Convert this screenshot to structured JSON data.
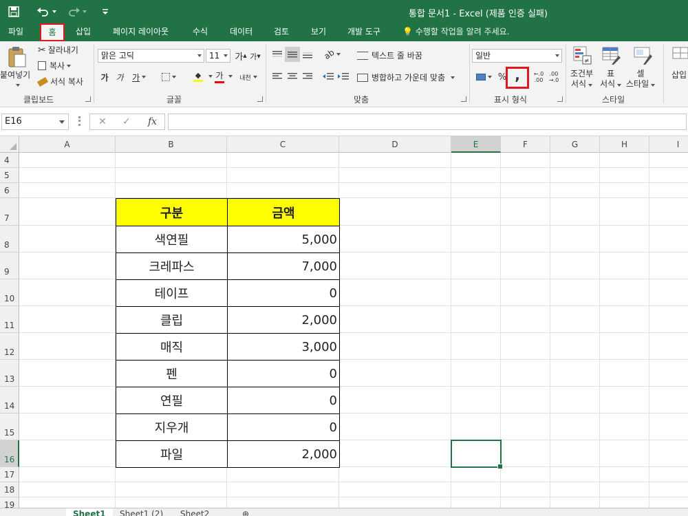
{
  "window": {
    "title": "통합 문서1 - Excel (제품 인증 실패)"
  },
  "quick_access": {
    "save_icon": "save-icon",
    "undo_icon": "undo-icon",
    "redo_icon": "redo-icon",
    "customize_icon": "customize-icon"
  },
  "tabs": [
    {
      "label": "파일"
    },
    {
      "label": "홈",
      "active": true
    },
    {
      "label": "삽입"
    },
    {
      "label": "페이지 레이아웃"
    },
    {
      "label": "수식"
    },
    {
      "label": "데이터"
    },
    {
      "label": "검토"
    },
    {
      "label": "보기"
    },
    {
      "label": "개발 도구"
    }
  ],
  "tell_me": "수행할 작업을 알려 주세요.",
  "ribbon": {
    "clipboard": {
      "paste": "붙여넣기",
      "cut": "잘라내기",
      "copy": "복사",
      "format_painter": "서식 복사",
      "label": "클립보드"
    },
    "font": {
      "name": "맑은 고딕",
      "size": "11",
      "grow": "가",
      "shrink": "가",
      "bold": "가",
      "italic": "가",
      "underline": "가",
      "font_color": "가",
      "phonetic": "내천",
      "label": "글꼴"
    },
    "alignment": {
      "wrap_text": "텍스트 줄 바꿈",
      "merge_center": "병합하고 가운데 맞춤",
      "label": "맞춤"
    },
    "number": {
      "format": "일반",
      "percent": "%",
      "comma": ",",
      "increase_decimal": ".00",
      "decrease_decimal": ".00",
      "label": "표시 형식"
    },
    "styles": {
      "conditional": "조건부",
      "conditional2": "서식",
      "as_table": "표",
      "as_table2": "서식",
      "cell_styles": "셀",
      "cell_styles2": "스타일",
      "label": "스타일"
    },
    "cells": {
      "insert": "삽입"
    }
  },
  "formula_bar": {
    "name_box": "E16",
    "cancel": "✕",
    "enter": "✓",
    "fx": "fx",
    "value": ""
  },
  "columns": [
    "A",
    "B",
    "C",
    "D",
    "E",
    "F",
    "G",
    "H",
    "I"
  ],
  "rows": [
    "4",
    "5",
    "6",
    "7",
    "8",
    "9",
    "10",
    "11",
    "12",
    "13",
    "14",
    "15",
    "16",
    "17",
    "18",
    "19"
  ],
  "selected_cell": {
    "column": "E",
    "row": "16"
  },
  "table": {
    "headers": [
      "구분",
      "금액"
    ],
    "rows": [
      {
        "item": "색연필",
        "amount": "5,000"
      },
      {
        "item": "크레파스",
        "amount": "7,000"
      },
      {
        "item": "테이프",
        "amount": "0"
      },
      {
        "item": "클립",
        "amount": "2,000"
      },
      {
        "item": "매직",
        "amount": "3,000"
      },
      {
        "item": "펜",
        "amount": "0"
      },
      {
        "item": "연필",
        "amount": "0"
      },
      {
        "item": "지우개",
        "amount": "0"
      },
      {
        "item": "파일",
        "amount": "2,000"
      }
    ],
    "header_color": "#ffff00"
  },
  "sheets": [
    {
      "name": "Sheet1",
      "active": true
    },
    {
      "name": "Sheet1 (2)"
    },
    {
      "name": "Sheet2"
    }
  ],
  "colors": {
    "excel_green": "#217346",
    "highlight_red": "#e0171f"
  }
}
